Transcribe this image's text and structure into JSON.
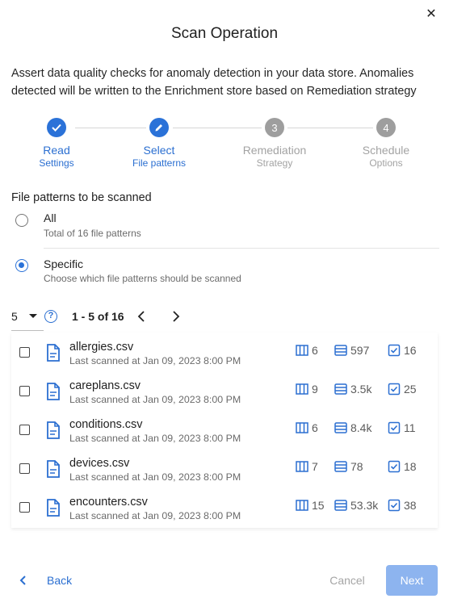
{
  "dialog": {
    "title": "Scan Operation",
    "description": "Assert data quality checks for anomaly detection in your data store. Anomalies detected will be written to the Enrichment store based on Remediation strategy"
  },
  "steps": [
    {
      "title": "Read",
      "subtitle": "Settings",
      "state": "completed",
      "marker": ""
    },
    {
      "title": "Select",
      "subtitle": "File patterns",
      "state": "active",
      "marker": ""
    },
    {
      "title": "Remediation",
      "subtitle": "Strategy",
      "state": "pending",
      "marker": "3"
    },
    {
      "title": "Schedule",
      "subtitle": "Options",
      "state": "pending",
      "marker": "4"
    }
  ],
  "section": {
    "title": "File patterns to be scanned"
  },
  "options": [
    {
      "label": "All",
      "sub": "Total of 16 file patterns",
      "selected": false
    },
    {
      "label": "Specific",
      "sub": "Choose which file patterns should be scanned",
      "selected": true
    }
  ],
  "pagination": {
    "page_size": "5",
    "range": "1 - 5 of 16"
  },
  "files": [
    {
      "name": "allergies.csv",
      "scanned": "Last scanned at Jan 09, 2023 8:00 PM",
      "fields": "6",
      "records": "597",
      "checks": "16"
    },
    {
      "name": "careplans.csv",
      "scanned": "Last scanned at Jan 09, 2023 8:00 PM",
      "fields": "9",
      "records": "3.5k",
      "checks": "25"
    },
    {
      "name": "conditions.csv",
      "scanned": "Last scanned at Jan 09, 2023 8:00 PM",
      "fields": "6",
      "records": "8.4k",
      "checks": "11"
    },
    {
      "name": "devices.csv",
      "scanned": "Last scanned at Jan 09, 2023 8:00 PM",
      "fields": "7",
      "records": "78",
      "checks": "18"
    },
    {
      "name": "encounters.csv",
      "scanned": "Last scanned at Jan 09, 2023 8:00 PM",
      "fields": "15",
      "records": "53.3k",
      "checks": "38"
    }
  ],
  "footer": {
    "back_label": "Back",
    "cancel_label": "Cancel",
    "next_label": "Next"
  },
  "colors": {
    "accent": "#2b72d8",
    "next_disabled": "#8db4ef",
    "inactive_step": "#9e9e9e"
  },
  "icons": {
    "close": "close-icon",
    "check": "check-icon",
    "edit": "pencil-icon",
    "file": "file-icon",
    "columns": "columns-icon",
    "records": "records-icon",
    "checks": "checks-icon"
  }
}
